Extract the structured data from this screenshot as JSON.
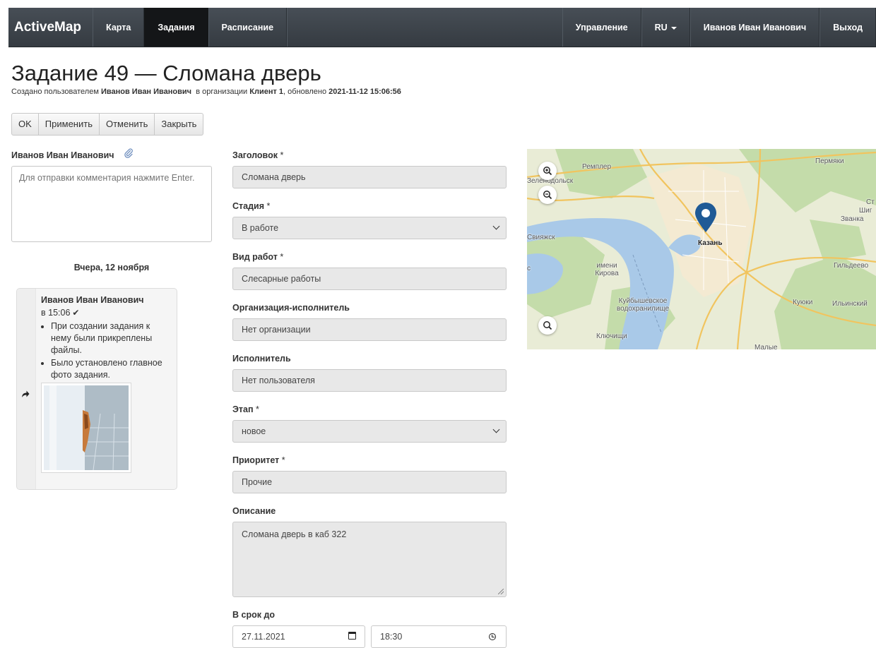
{
  "nav": {
    "brand": "ActiveMap",
    "items_left": [
      "Карта",
      "Задания",
      "Расписание"
    ],
    "active": "Задания",
    "manage": "Управление",
    "lang": "RU",
    "user": "Иванов Иван Иванович",
    "logout": "Выход"
  },
  "header": {
    "title": "Задание 49 — Сломана дверь",
    "created_prefix": "Создано пользователем",
    "author": "Иванов Иван Иванович",
    "org_prefix": "в организации",
    "org": "Клиент 1",
    "updated_prefix": ", обновлено",
    "updated": "2021-11-12 15:06:56"
  },
  "toolbar": {
    "ok": "OK",
    "apply": "Применить",
    "cancel": "Отменить",
    "close": "Закрыть"
  },
  "comments": {
    "user": "Иванов Иван Иванович",
    "placeholder": "Для отправки комментария нажмите Enter.",
    "day_separator": "Вчера, 12 ноября",
    "history": {
      "author": "Иванов Иван Иванович",
      "time": "в 15:06",
      "items": [
        "При создании задания к нему были прикреплены файлы.",
        "Было установлено главное фото задания."
      ]
    }
  },
  "form": {
    "title_label": "Заголовок",
    "title_value": "Сломана дверь",
    "stage_label": "Стадия",
    "stage_value": "В работе",
    "work_type_label": "Вид работ",
    "work_type_value": "Слесарные работы",
    "executor_org_label": "Организация-исполнитель",
    "executor_org_value": "Нет организации",
    "executor_label": "Исполнитель",
    "executor_value": "Нет пользователя",
    "phase_label": "Этап",
    "phase_value": "новое",
    "priority_label": "Приоритет",
    "priority_value": "Прочие",
    "description_label": "Описание",
    "description_value": "Сломана дверь в каб 322",
    "deadline_label": "В срок до",
    "deadline_date": "27.11.2021",
    "deadline_time": "18:30",
    "required_mark": "*"
  },
  "map": {
    "labels": [
      "Ремплер",
      "Пермяки",
      "Зеленодольск",
      "Званка",
      "Казань",
      "имени Кирова",
      "Гильдеево",
      "Куйбышевское водохранилище",
      "Куюки",
      "Ильинский",
      "Ключищи",
      "Малые",
      "Ст",
      "Шиг",
      "Свияжск",
      "с"
    ],
    "colors": {
      "marker": "#1f5a96",
      "water": "#a9c9e8",
      "land": "#e9ecd6",
      "forest": "#c4dcaa",
      "road": "#f1c45e"
    }
  },
  "icons": {
    "attach": "paperclip-icon",
    "check": "check-icon",
    "share": "share-icon",
    "zoom_in": "zoom-in-icon",
    "zoom_out": "zoom-out-icon",
    "search": "search-icon"
  }
}
